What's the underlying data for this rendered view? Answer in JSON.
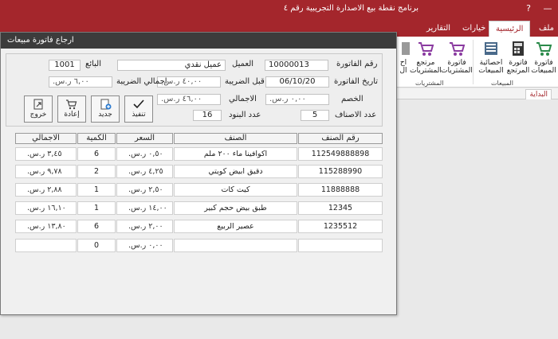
{
  "window": {
    "title": "برنامج نقطة بيع الاصدارة التجريبية رقم ٤"
  },
  "window_buttons": {
    "help": "?",
    "minimize": "—"
  },
  "ribbon_tabs": [
    {
      "label": "ملف"
    },
    {
      "label": "الرئيسية"
    },
    {
      "label": "خيارات"
    },
    {
      "label": "التقارير"
    }
  ],
  "ribbon": {
    "buttons": [
      {
        "label": "فاتورة المبيعات"
      },
      {
        "label": "فاتورة المرتجع"
      },
      {
        "label": "احصائية المبيعات"
      },
      {
        "label": "فاتورة المشتريات"
      },
      {
        "label": "مرتجع المشتريات"
      },
      {
        "label": "اح ال"
      }
    ],
    "groups": {
      "sales": "المبيعات",
      "purchases": "المشتريات"
    }
  },
  "nav": {
    "start_tab": "البداية"
  },
  "dialog": {
    "title": "ارجاع فاتورة مبيعات",
    "fields": {
      "invoice_no_label": "رقم الفاتورة",
      "invoice_no": "10000013",
      "customer_label": "العميل",
      "customer": "عميل نقدي",
      "seller_label": "البائع",
      "seller": "1001",
      "invoice_date_label": "تاريخ الفاتورة",
      "invoice_date": "06/10/20",
      "before_tax_label": "قبل الضريبة",
      "before_tax": "٤٠,٠٠ ر.س.",
      "total_tax_label": "اجمالي الضريبة",
      "total_tax": "٦,٠٠ ر.س.",
      "discount_label": "الخصم",
      "discount": "٠,٠٠ ر.س.",
      "total_label": "الاجمالي",
      "total": "٤٦,٠٠ ر.س.",
      "items_count_label": "عدد الاصناف",
      "items_count": "5",
      "lines_count_label": "عدد البنود",
      "lines_count": "16"
    },
    "actions": {
      "execute": "تنفيذ",
      "new": "جديد",
      "reprint": "إعادة",
      "exit": "خروج"
    },
    "table": {
      "headers": {
        "code": "رقم الصنف",
        "item": "الصنف",
        "price": "السعر",
        "qty": "الكمية",
        "total": "الاجمالي"
      },
      "rows": [
        {
          "code": "112549888898",
          "item": "اكوافينا ماء ٢٠٠ ملم",
          "price": "٠,٥٠ ر.س.",
          "qty": "6",
          "total": "٣,٤٥ ر.س."
        },
        {
          "code": "115288990",
          "item": "دقيق ابيض كويتي",
          "price": "٤,٢٥ ر.س.",
          "qty": "2",
          "total": "٩,٧٨ ر.س."
        },
        {
          "code": "11888888",
          "item": "كيت كات",
          "price": "٢,٥٠ ر.س.",
          "qty": "1",
          "total": "٢,٨٨ ر.س."
        },
        {
          "code": "12345",
          "item": "طبق بيض حجم كبير",
          "price": "١٤,٠٠ ر.س.",
          "qty": "1",
          "total": "١٦,١٠ ر.س."
        },
        {
          "code": "1235512",
          "item": "عصير الربيع",
          "price": "٢,٠٠ ر.س.",
          "qty": "6",
          "total": "١٣,٨٠ ر.س."
        },
        {
          "code": "",
          "item": "",
          "price": "٠,٠٠ ر.س.",
          "qty": "0",
          "total": ""
        }
      ]
    }
  },
  "colors": {
    "accent": "#a4262c",
    "dialog_title": "#3c3c3c"
  }
}
